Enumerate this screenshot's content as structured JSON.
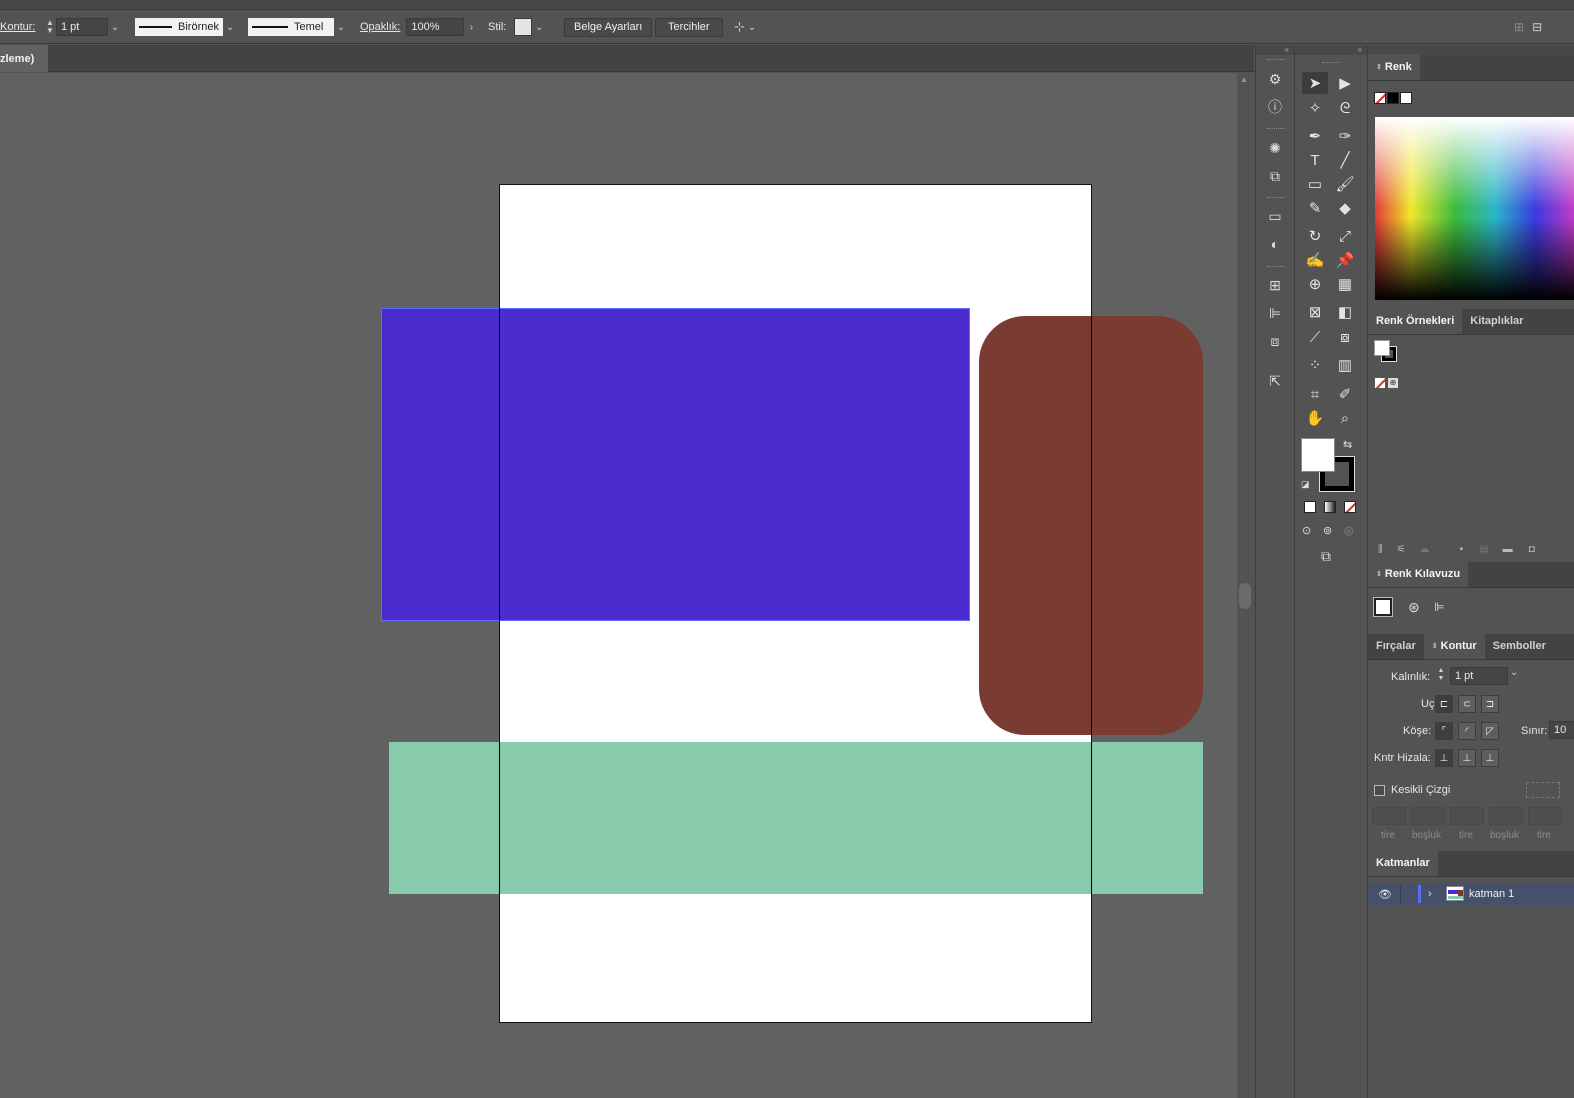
{
  "control_bar": {
    "stroke_label": "Kontur:",
    "stroke_weight": "1 pt",
    "profile_1": "Birörnek",
    "profile_2": "Temel",
    "opacity_label": "Opaklık:",
    "opacity_value": "100%",
    "style_label": "Stil:",
    "doc_setup_button": "Belge Ayarları",
    "preferences_button": "Tercihler"
  },
  "document_tab": {
    "title": "zleme)"
  },
  "canvas": {
    "background": "#616161",
    "artboard_color": "#ffffff",
    "shapes": [
      {
        "name": "purple-rectangle",
        "color": "#4a2ccf"
      },
      {
        "name": "brown-rounded-rectangle",
        "color": "#7a3b33"
      },
      {
        "name": "mint-rectangle",
        "color": "#89cbad"
      }
    ]
  },
  "tools_panel": {
    "tools": [
      "selection-tool",
      "direct-selection-tool",
      "magic-wand-tool",
      "lasso-tool",
      "pen-tool",
      "curvature-tool",
      "type-tool",
      "line-tool",
      "rectangle-tool",
      "paintbrush-tool",
      "shaper-tool",
      "eraser-tool",
      "rotate-tool",
      "scale-tool",
      "warp-tool",
      "puppet-warp-tool",
      "shape-builder-tool",
      "perspective-grid-tool",
      "mesh-tool",
      "gradient-tool",
      "eyedropper-tool",
      "blend-tool",
      "symbol-sprayer-tool",
      "graph-tool",
      "artboard-tool",
      "slice-tool",
      "hand-tool",
      "zoom-tool"
    ]
  },
  "color_panel": {
    "title": "Renk"
  },
  "swatches_panel": {
    "tab_swatches": "Renk Örnekleri",
    "tab_libraries": "Kitaplıklar"
  },
  "color_guide_panel": {
    "title": "Renk Kılavuzu"
  },
  "stroke_panel": {
    "tab_brushes": "Fırçalar",
    "tab_stroke": "Kontur",
    "tab_symbols": "Semboller",
    "weight_label": "Kalınlık:",
    "weight_value": "1 pt",
    "cap_label": "Uç:",
    "corner_label": "Köşe:",
    "limit_label": "Sınır:",
    "limit_value": "10",
    "align_label": "Kntr Hizala:",
    "dashed_label": "Kesikli Çizgi",
    "dash_fields": [
      "tire",
      "boşluk",
      "tire",
      "boşluk",
      "tire"
    ]
  },
  "layers_panel": {
    "title": "Katmanlar",
    "layers": [
      {
        "name": "katman 1",
        "color": "#5a6ef0"
      }
    ]
  }
}
